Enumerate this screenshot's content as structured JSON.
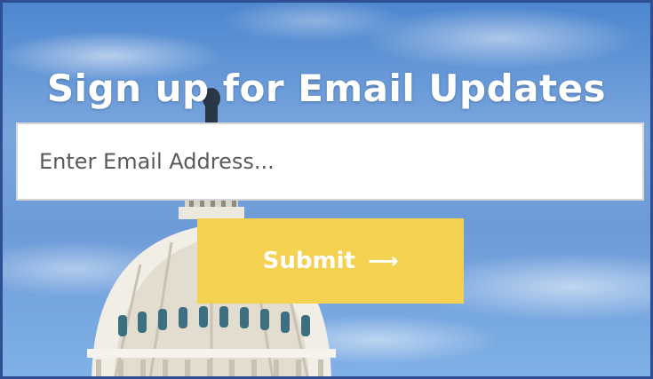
{
  "form": {
    "title": "Sign up for Email Updates",
    "email_placeholder": "Enter Email Address...",
    "email_value": "",
    "submit_label": "Submit",
    "submit_icon": "arrow-right-icon"
  },
  "colors": {
    "border": "#2f4f94",
    "sky": "#6d9bd8",
    "submit_background": "#f4d150",
    "submit_text": "#ffffff",
    "title_text": "#ffffff"
  },
  "background_image": "capitol-dome-against-blue-sky"
}
